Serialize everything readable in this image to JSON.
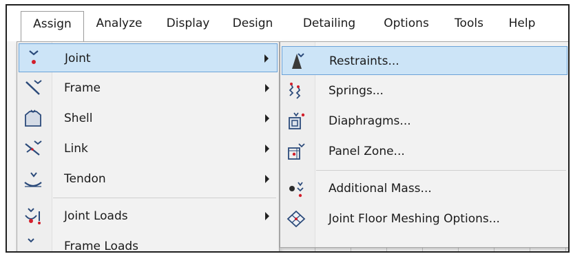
{
  "menubar": {
    "items": [
      "Assign",
      "Analyze",
      "Display",
      "Design",
      "Detailing",
      "Options",
      "Tools",
      "Help"
    ],
    "active": "Assign"
  },
  "assign_menu": {
    "items": [
      {
        "label": "Joint",
        "icon": "joint-icon",
        "submenu": true,
        "highlighted": true
      },
      {
        "label": "Frame",
        "icon": "frame-icon",
        "submenu": true
      },
      {
        "label": "Shell",
        "icon": "shell-icon",
        "submenu": true
      },
      {
        "label": "Link",
        "icon": "link-icon",
        "submenu": true
      },
      {
        "label": "Tendon",
        "icon": "tendon-icon",
        "submenu": true
      },
      {
        "label": "Joint Loads",
        "icon": "joint-loads-icon",
        "submenu": true
      },
      {
        "label": "Frame Loads",
        "icon": "frame-loads-icon",
        "submenu": true
      }
    ]
  },
  "joint_submenu": {
    "items": [
      {
        "label": "Restraints...",
        "icon": "restraints-icon",
        "highlighted": true
      },
      {
        "label": "Springs...",
        "icon": "springs-icon"
      },
      {
        "label": "Diaphragms...",
        "icon": "diaphragms-icon"
      },
      {
        "label": "Panel Zone...",
        "icon": "panel-zone-icon"
      },
      {
        "label": "Additional Mass...",
        "icon": "additional-mass-icon"
      },
      {
        "label": "Joint Floor Meshing Options...",
        "icon": "floor-meshing-icon"
      }
    ]
  },
  "colors": {
    "highlight_bg": "#cce4f7",
    "highlight_border": "#6aa2d8",
    "accent_red": "#d21e2b",
    "icon_blue": "#2b4a7a"
  }
}
